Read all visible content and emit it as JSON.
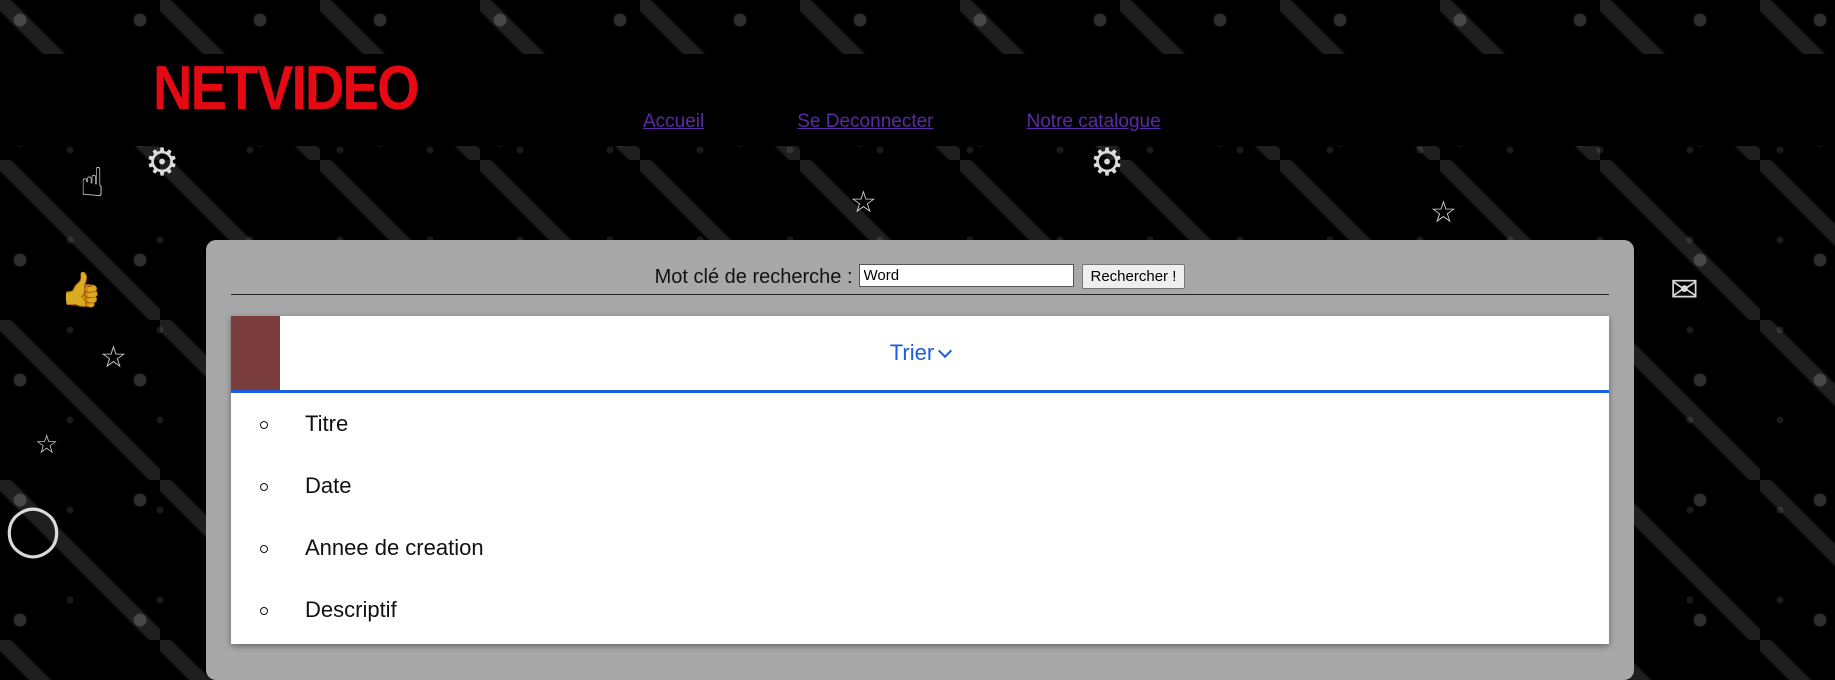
{
  "header": {
    "logo": "NETVIDEO",
    "nav": [
      "Accueil",
      "Se Deconnecter",
      "Notre catalogue"
    ]
  },
  "search": {
    "label": "Mot clé de recherche :",
    "value": "Word",
    "button_label": "Rechercher !"
  },
  "sort": {
    "title": "Trier",
    "options": [
      "Titre",
      "Date",
      "Annee de creation",
      "Descriptif"
    ]
  },
  "colors": {
    "logo": "#e50914",
    "link": "#5b2aa6",
    "accent": "#1a5fe0",
    "panel": "#a8a8a8",
    "swatch": "#7a3c3c"
  }
}
